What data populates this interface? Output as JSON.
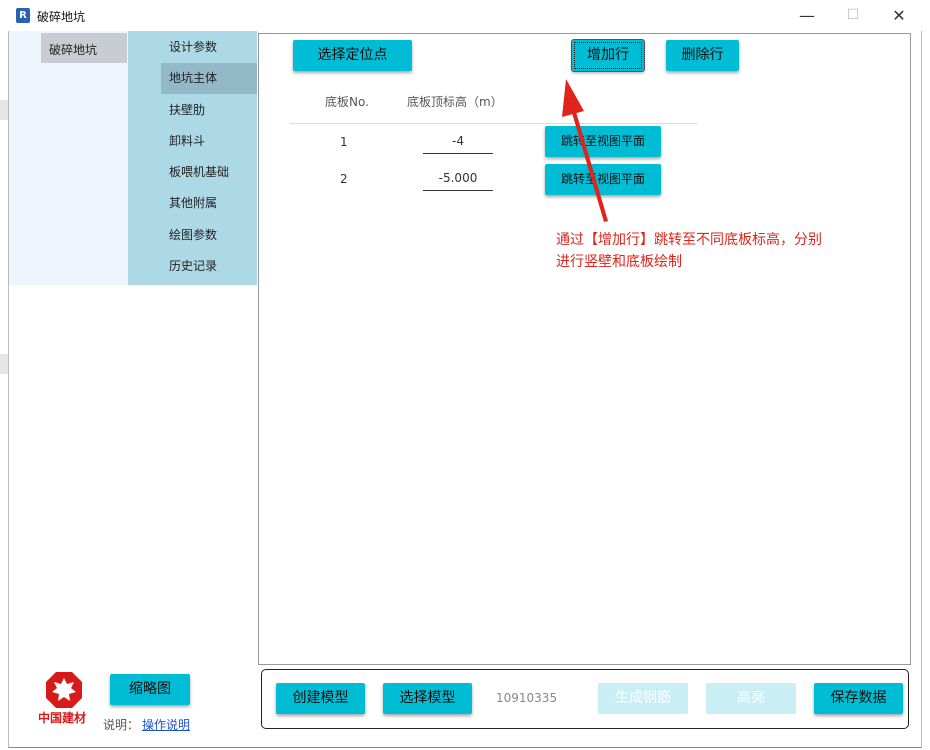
{
  "window": {
    "title": "破碎地坑",
    "logo_letter": "R",
    "minimize": "—",
    "maximize": "☐",
    "close": "✕"
  },
  "nav": {
    "primary": [
      "破碎地坑"
    ],
    "secondary": [
      "设计参数",
      "地坑主体",
      "扶壁肋",
      "卸料斗",
      "板喂机基础",
      "其他附属",
      "绘图参数",
      "历史记录"
    ],
    "active_secondary": "地坑主体"
  },
  "toolbar": {
    "select_point": "选择定位点",
    "add_row": "增加行",
    "delete_row": "删除行"
  },
  "table": {
    "headers": [
      "底板No.",
      "底板顶标高（m）"
    ],
    "rows": [
      {
        "no": "1",
        "elevation": "-4",
        "action": "跳转至视图平面"
      },
      {
        "no": "2",
        "elevation": "-5.000",
        "action": "跳转至视图平面"
      }
    ]
  },
  "annotation": {
    "line1": "通过【增加行】跳转至不同底板标高，分别",
    "line2": "进行竖壁和底板绘制"
  },
  "left_bottom": {
    "thumbnail": "缩略图",
    "brand": "中国建材",
    "help_label": "说明：",
    "help_link": "操作说明"
  },
  "bottom_bar": {
    "create_model": "创建模型",
    "select_model": "选择模型",
    "serial": "10910335",
    "gen_rebar": "生成钢筋",
    "highlight": "高亮",
    "save_data": "保存数据"
  },
  "colors": {
    "accent": "#00bcd4",
    "nav": "#add8e6",
    "annotation": "#e0241b"
  }
}
